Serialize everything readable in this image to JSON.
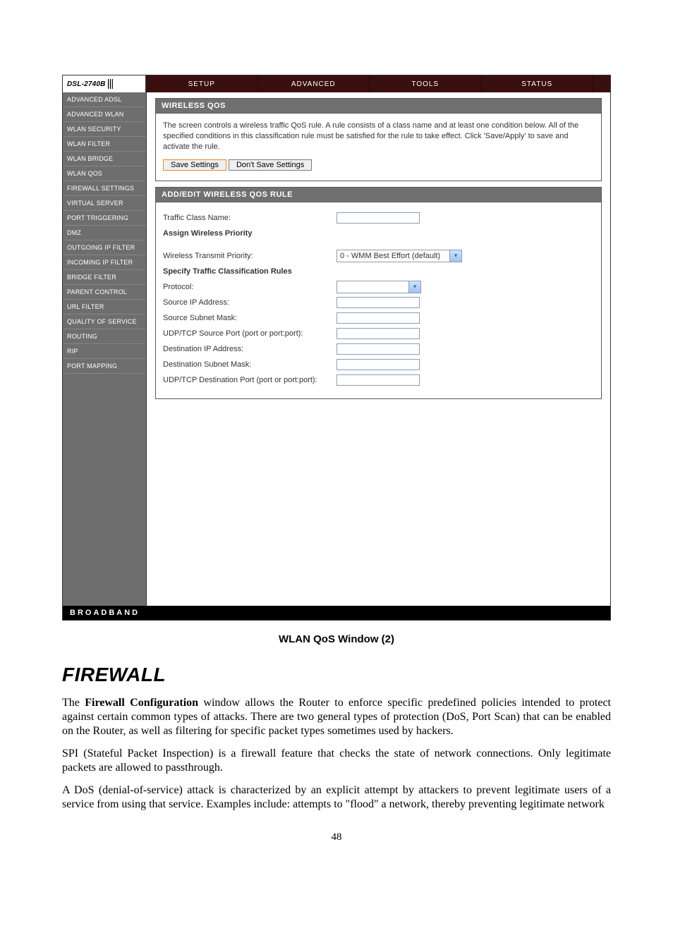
{
  "logo": "DSL-2740B",
  "tabs": [
    "SETUP",
    "ADVANCED",
    "TOOLS",
    "STATUS"
  ],
  "sidebar": {
    "items": [
      "ADVANCED ADSL",
      "ADVANCED WLAN",
      "WLAN SECURITY",
      "WLAN FILTER",
      "WLAN BRIDGE",
      "WLAN QOS",
      "FIREWALL SETTINGS",
      "VIRTUAL SERVER",
      "PORT TRIGGERING",
      "DMZ",
      "OUTGOING IP FILTER",
      "INCOMING IP FILTER",
      "BRIDGE FILTER",
      "PARENT CONTROL",
      "URL FILTER",
      "QUALITY OF SERVICE",
      "ROUTING",
      "RIP",
      "PORT MAPPING"
    ]
  },
  "panel1": {
    "title": "WIRELESS QOS",
    "text": "The screen controls  a wireless traffic QoS rule. A rule consists of a class name and at least one condition below. All of the specified conditions in this classification rule must be satisfied for the rule to take effect. Click 'Save/Apply' to save and activate the rule.",
    "save": "Save Settings",
    "dont": "Don't Save Settings"
  },
  "panel2": {
    "title": "ADD/EDIT WIRELESS QOS RULE",
    "rows": {
      "r0": "Traffic Class Name:",
      "h0": "Assign Wireless Priority",
      "r1": "Wireless Transmit Priority:",
      "h1": "Specify Traffic Classification Rules",
      "r2": "Protocol:",
      "r3": "Source IP Address:",
      "r4": "Source Subnet Mask:",
      "r5": "UDP/TCP Source Port (port or port:port):",
      "r6": "Destination IP Address:",
      "r7": "Destination Subnet Mask:",
      "r8": "UDP/TCP Destination Port (port or port:port):"
    },
    "priority_value": "0 - WMM Best Effort (default)"
  },
  "footer": "BROADBAND",
  "caption": "WLAN QoS Window (2)",
  "section_title": "FIREWALL",
  "doc": {
    "p1a": "The ",
    "p1b": "Firewall Configuration",
    "p1c": " window allows the Router to enforce specific predefined policies intended to protect against certain common types of attacks. There are two general types of protection (DoS, Port Scan) that can be enabled on the Router, as well as filtering for specific packet types sometimes used by hackers.",
    "p2": "SPI (Stateful Packet Inspection) is a firewall feature that checks the state of network connections. Only legitimate packets are allowed to passthrough.",
    "p3": "A DoS (denial-of-service) attack is characterized by an explicit attempt by attackers to prevent legitimate users of a service from using that service. Examples include: attempts to \"flood\" a network, thereby preventing legitimate network"
  },
  "page_number": "48"
}
